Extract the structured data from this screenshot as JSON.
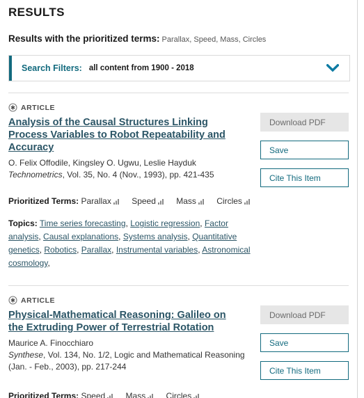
{
  "header": {
    "results_heading": "RESULTS",
    "prioritized_label": "Results with the prioritized terms:",
    "prioritized_values": "Parallax, Speed, Mass, Circles"
  },
  "search_filters": {
    "label": "Search Filters:",
    "value": "all content from 1900 - 2018",
    "chevron_icon": "chevron-down-icon",
    "accent_color": "#126a7e"
  },
  "labels": {
    "prioritized_terms": "Prioritized Terms:",
    "topics": "Topics:",
    "content_type": "ARTICLE"
  },
  "buttons": {
    "download_pdf": "Download PDF",
    "save": "Save",
    "cite_this_item": "Cite This Item"
  },
  "results": [
    {
      "type": "ARTICLE",
      "title": "Analysis of the Causal Structures Linking Process Variables to Robot Repeatability and Accuracy",
      "authors": "O. Felix Offodile, Kingsley O. Ugwu, Leslie Hayduk",
      "journal": "Technometrics",
      "source_rest": ", Vol. 35, No. 4 (Nov., 1993), pp. 421-435",
      "prioritized_terms": [
        "Parallax",
        "Speed",
        "Mass",
        "Circles"
      ],
      "topics": [
        "Time series forecasting",
        "Logistic regression",
        "Factor analysis",
        "Causal explanations",
        "Systems analysis",
        "Quantitative genetics",
        "Robotics",
        "Parallax",
        "Instrumental variables",
        "Astronomical cosmology"
      ]
    },
    {
      "type": "ARTICLE",
      "title": "Physical-Mathematical Reasoning: Galileo on the Extruding Power of Terrestrial Rotation",
      "authors": "Maurice A. Finocchiaro",
      "journal": "Synthese",
      "source_rest": ", Vol. 134, No. 1/2, Logic and Mathematical Reasoning",
      "source_line2": "(Jan. - Feb., 2003), pp. 217-244",
      "prioritized_terms": [
        "Speed",
        "Mass",
        "Circles"
      ],
      "topics": []
    }
  ],
  "colors": {
    "accent": "#126a7e",
    "link": "#2b5566",
    "disabled_bg": "#e6e6e6",
    "divider": "#dddddd"
  }
}
